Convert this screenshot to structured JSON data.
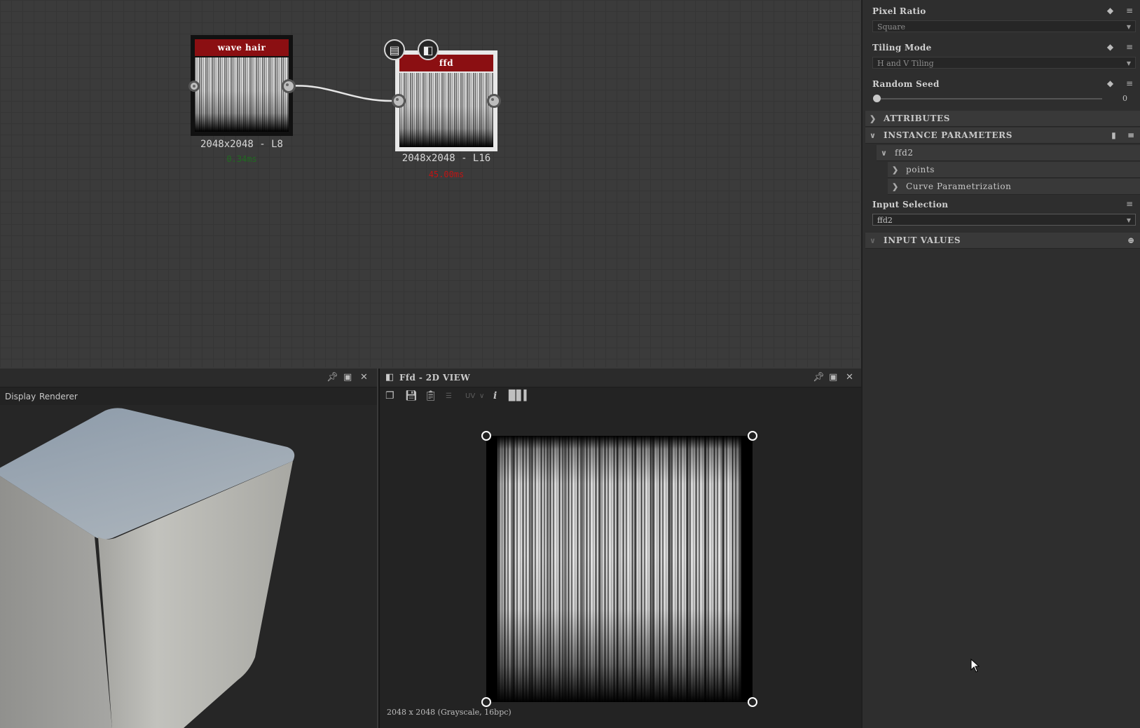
{
  "graph": {
    "nodes": [
      {
        "title": "wave hair",
        "info": "2048x2048 - L8",
        "time": "0.34ms",
        "time_color": "#1f6b1f"
      },
      {
        "title": "ffd",
        "info": "2048x2048 - L16",
        "time": "45.00ms",
        "time_color": "#c01414"
      }
    ]
  },
  "properties": {
    "pixel_ratio": {
      "label": "Pixel Ratio",
      "value": "Square"
    },
    "tiling_mode": {
      "label": "Tiling Mode",
      "value": "H and V Tiling"
    },
    "random_seed": {
      "label": "Random Seed",
      "value": "0",
      "level": 0
    },
    "sections": {
      "attributes": "ATTRIBUTES",
      "instance_parameters": "INSTANCE PARAMETERS",
      "ffd2": "ffd2",
      "points": "points",
      "curve_param": "Curve Parametrization",
      "input_values": "INPUT VALUES"
    },
    "input_selection": {
      "label": "Input Selection",
      "value": "ffd2"
    }
  },
  "viewport3d": {
    "menu": [
      "Display",
      "Renderer"
    ]
  },
  "view2d": {
    "title": "Ffd - 2D VIEW",
    "uv_label": "UV",
    "status": "2048 x 2048 (Grayscale, 16bpc)"
  },
  "colors": {
    "node_title": "#8b0f12",
    "accent": "#8b0f12"
  }
}
